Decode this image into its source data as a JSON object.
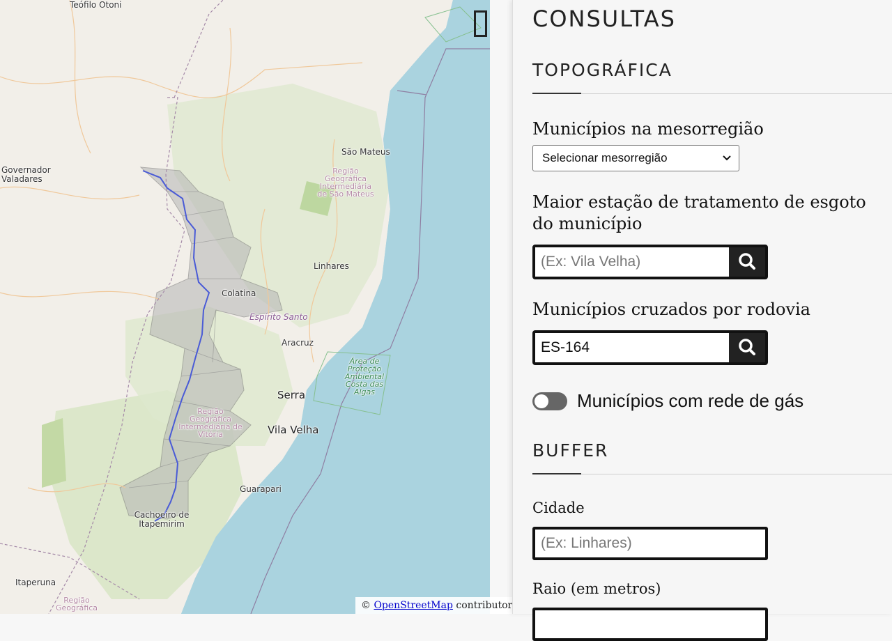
{
  "map": {
    "labels": {
      "teofilo_otoni": "Teófilo Otoni",
      "governador_valadares": "Governador\nValadares",
      "sao_mateus": "São Mateus",
      "regiao_sao_mateus": "Região Geográfica Intermediária de São Mateus",
      "linhares": "Linhares",
      "colatina": "Colatina",
      "espirito_santo": "Espírito Santo",
      "aracruz": "Aracruz",
      "area_protecao": "Área de Proteção Ambiental Costa das Algas",
      "serra": "Serra",
      "regiao_vitoria": "Região Geográfica Intermediária de Vitória",
      "vila_velha": "Vila Velha",
      "guarapari": "Guarapari",
      "cachoeiro": "Cachoeiro de Itapemirim",
      "itaperuna": "Itaperuna",
      "regiao_bottom": "Região Geográfica"
    },
    "attribution": {
      "prefix": "© ",
      "link": "OpenStreetMap",
      "suffix": " contributors."
    }
  },
  "sidebar": {
    "title": "CONSULTAS",
    "topografica": {
      "heading": "TOPOGRÁFICA",
      "mesorregiao_label": "Municípios na mesorregião",
      "mesorregiao_select": "Selecionar mesorregião",
      "esgoto_label": "Maior estação de tratamento de esgoto do município",
      "esgoto_placeholder": "(Ex: Vila Velha)",
      "rodovia_label": "Municípios cruzados por rodovia",
      "rodovia_value": "ES-164",
      "gas_toggle_label": "Municípios com rede de gás",
      "gas_toggle_on": false
    },
    "buffer": {
      "heading": "BUFFER",
      "cidade_label": "Cidade",
      "cidade_placeholder": "(Ex: Linhares)",
      "raio_label": "Raio (em metros)"
    }
  },
  "colors": {
    "land": "#f2efe9",
    "water": "#aad3df",
    "selected_region": "#b9b9b9",
    "route": "#4a5bd6",
    "button_dark": "#222222"
  },
  "icons": [
    "search-icon",
    "layers-toggle-icon"
  ]
}
